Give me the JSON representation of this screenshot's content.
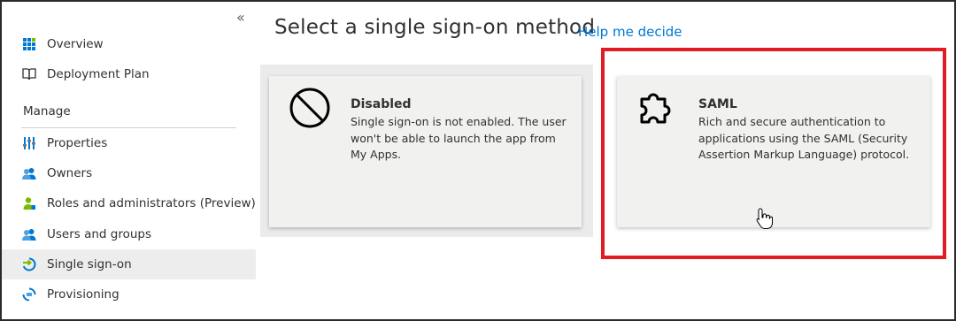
{
  "sidebar": {
    "collapse_glyph": "«",
    "items": [
      {
        "label": "Overview",
        "icon": "overview-grid-icon"
      },
      {
        "label": "Deployment Plan",
        "icon": "book-icon"
      }
    ],
    "manage_section": "Manage",
    "manage_items": [
      {
        "label": "Properties",
        "icon": "properties-sliders-icon"
      },
      {
        "label": "Owners",
        "icon": "owners-people-icon"
      },
      {
        "label": "Roles and administrators (Preview)",
        "icon": "roles-user-icon"
      },
      {
        "label": "Users and groups",
        "icon": "users-groups-icon"
      },
      {
        "label": "Single sign-on",
        "icon": "single-sign-on-icon",
        "active": true
      },
      {
        "label": "Provisioning",
        "icon": "provisioning-icon"
      }
    ]
  },
  "main": {
    "title": "Select a single sign-on method",
    "help_link": "Help me decide",
    "tiles": [
      {
        "heading": "Disabled",
        "description": "Single sign-on is not enabled. The user won't be able to launch the app from My Apps.",
        "icon": "prohibited-icon"
      },
      {
        "heading": "SAML",
        "description": "Rich and secure authentication to applications using the SAML (Security Assertion Markup Language) protocol.",
        "icon": "puzzle-piece-icon"
      }
    ]
  },
  "colors": {
    "link": "#0078d4",
    "highlight_border": "#e31b23",
    "active_nav_bg": "#ededed",
    "tile_bg": "#f1f1f0"
  }
}
